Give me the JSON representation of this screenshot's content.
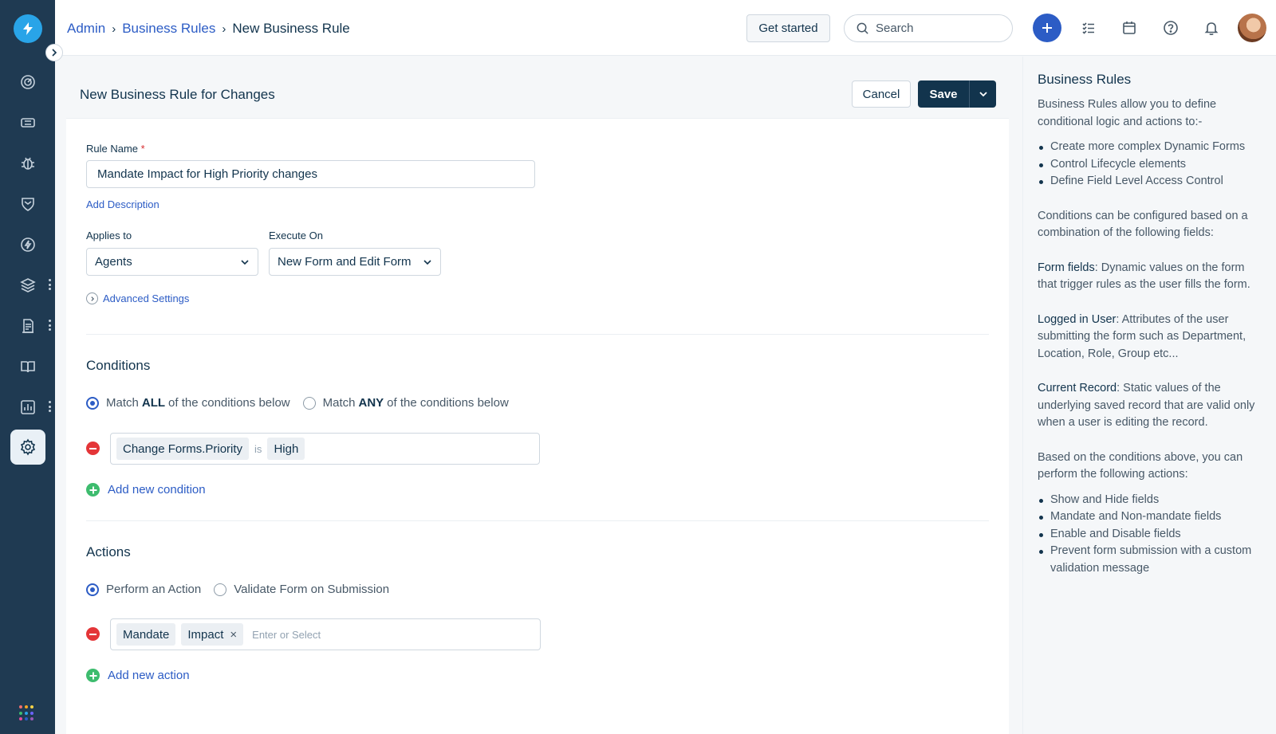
{
  "breadcrumb": {
    "admin": "Admin",
    "business_rules": "Business Rules",
    "current": "New Business Rule"
  },
  "header": {
    "get_started": "Get started",
    "search_placeholder": "Search"
  },
  "form": {
    "title": "New Business Rule for Changes",
    "cancel": "Cancel",
    "save": "Save",
    "rule_name_label": "Rule Name",
    "required_mark": "*",
    "rule_name_value": "Mandate Impact for High Priority changes",
    "add_description": "Add Description",
    "applies_to_label": "Applies to",
    "applies_to_value": "Agents",
    "execute_on_label": "Execute On",
    "execute_on_value": "New Form and Edit Form",
    "advanced_settings": "Advanced Settings"
  },
  "conditions": {
    "title": "Conditions",
    "match_all_prefix": "Match",
    "match_all_keyword": "ALL",
    "match_all_suffix": "of the conditions below",
    "match_any_prefix": "Match",
    "match_any_keyword": "ANY",
    "match_any_suffix": "of the conditions below",
    "selected": "all",
    "rule_field": "Change Forms.Priority",
    "rule_operator": "is",
    "rule_value": "High",
    "add_new": "Add new condition"
  },
  "actions": {
    "title": "Actions",
    "perform_label": "Perform an Action",
    "validate_label": "Validate Form on Submission",
    "selected": "perform",
    "action_type": "Mandate",
    "action_field": "Impact",
    "remove_symbol": "×",
    "input_placeholder": "Enter or Select",
    "add_new": "Add new action"
  },
  "help_panel": {
    "title": "Business Rules",
    "intro": "Business Rules allow you to define conditional logic and actions to:-",
    "uses": [
      "Create more complex Dynamic Forms",
      "Control Lifecycle elements",
      "Define Field Level Access Control"
    ],
    "conditions_intro": "Conditions can be configured based on a combination of the following fields:",
    "form_fields_term": "Form fields",
    "form_fields_desc": ": Dynamic values on the form that trigger rules as the user fills the form.",
    "logged_user_term": "Logged in User",
    "logged_user_desc": ": Attributes of the user submitting the form such as Department, Location, Role, Group etc...",
    "current_record_term": "Current Record",
    "current_record_desc": ": Static values of the underlying saved record that are valid only when a user is editing the record.",
    "actions_intro": "Based on the conditions above, you can perform the following actions:",
    "actions": [
      "Show and Hide fields",
      "Mandate and Non-mandate fields",
      "Enable and Disable fields",
      "Prevent form submission with a custom validation message"
    ]
  },
  "nav_icons": [
    "dashboard-icon",
    "tickets-icon",
    "problems-icon",
    "changes-icon",
    "releases-icon",
    "assets-icon",
    "purchase-orders-icon",
    "solutions-icon",
    "reports-icon",
    "admin-gear-icon"
  ],
  "colors": {
    "nav_bg": "#1f3a52",
    "link": "#2c5cc5",
    "primary_dark": "#12344d",
    "danger": "#e43538",
    "success": "#3dbc6e",
    "logo": "#29a4e8"
  }
}
